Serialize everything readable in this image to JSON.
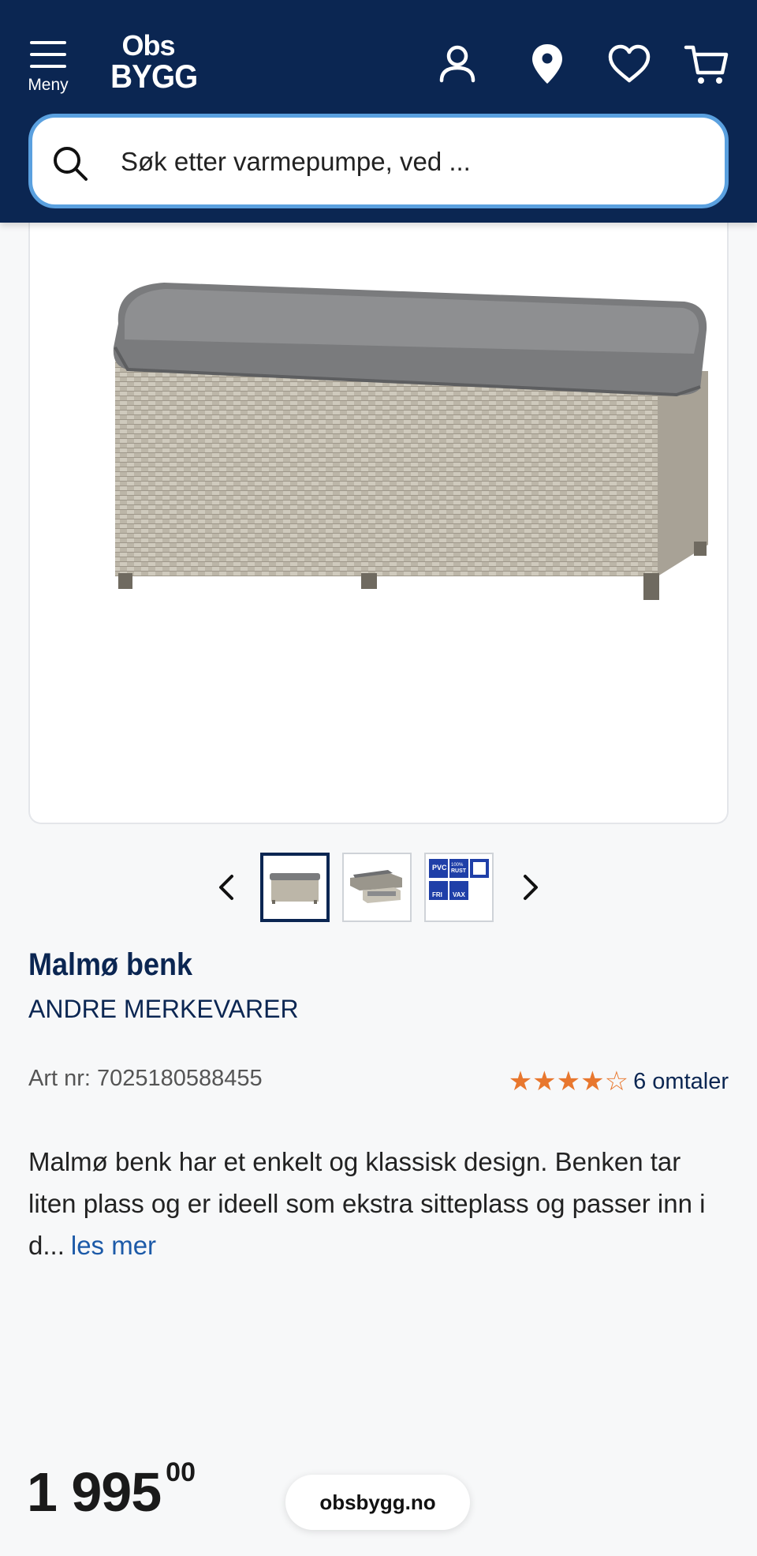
{
  "header": {
    "menu_label": "Meny",
    "logo_line1": "Obs",
    "logo_line2": "BYGG",
    "icons": [
      "account-icon",
      "location-pin-icon",
      "heart-icon",
      "cart-icon"
    ]
  },
  "search": {
    "placeholder": "Søk etter varmepumpe, ved ..."
  },
  "gallery": {
    "thumbnails": [
      "bench-thumbnail",
      "sofa-set-thumbnail",
      "certification-badges-thumbnail"
    ],
    "active_index": 0,
    "badge_labels": [
      "PVC FRI",
      "100% RUST FRI",
      "FRI",
      "VAX"
    ]
  },
  "product": {
    "title": "Malmø benk",
    "brand": "ANDRE MERKEVARER",
    "art_nr": "Art nr: 7025180588455",
    "rating": 4,
    "rating_max": 5,
    "reviews_label": "6 omtaler",
    "description": "Malmø benk har et enkelt og klassisk design. Benken tar liten plass og er ideell som ekstra sitteplass og passer inn i d...",
    "read_more": "les mer"
  },
  "price": {
    "main": "1 995",
    "decimals": "00"
  },
  "browser": {
    "url": "obsbygg.no"
  },
  "colors": {
    "header_bg": "#0b2652",
    "search_border": "#5aa0df",
    "star": "#e8772e",
    "link": "#1c5aa8"
  }
}
